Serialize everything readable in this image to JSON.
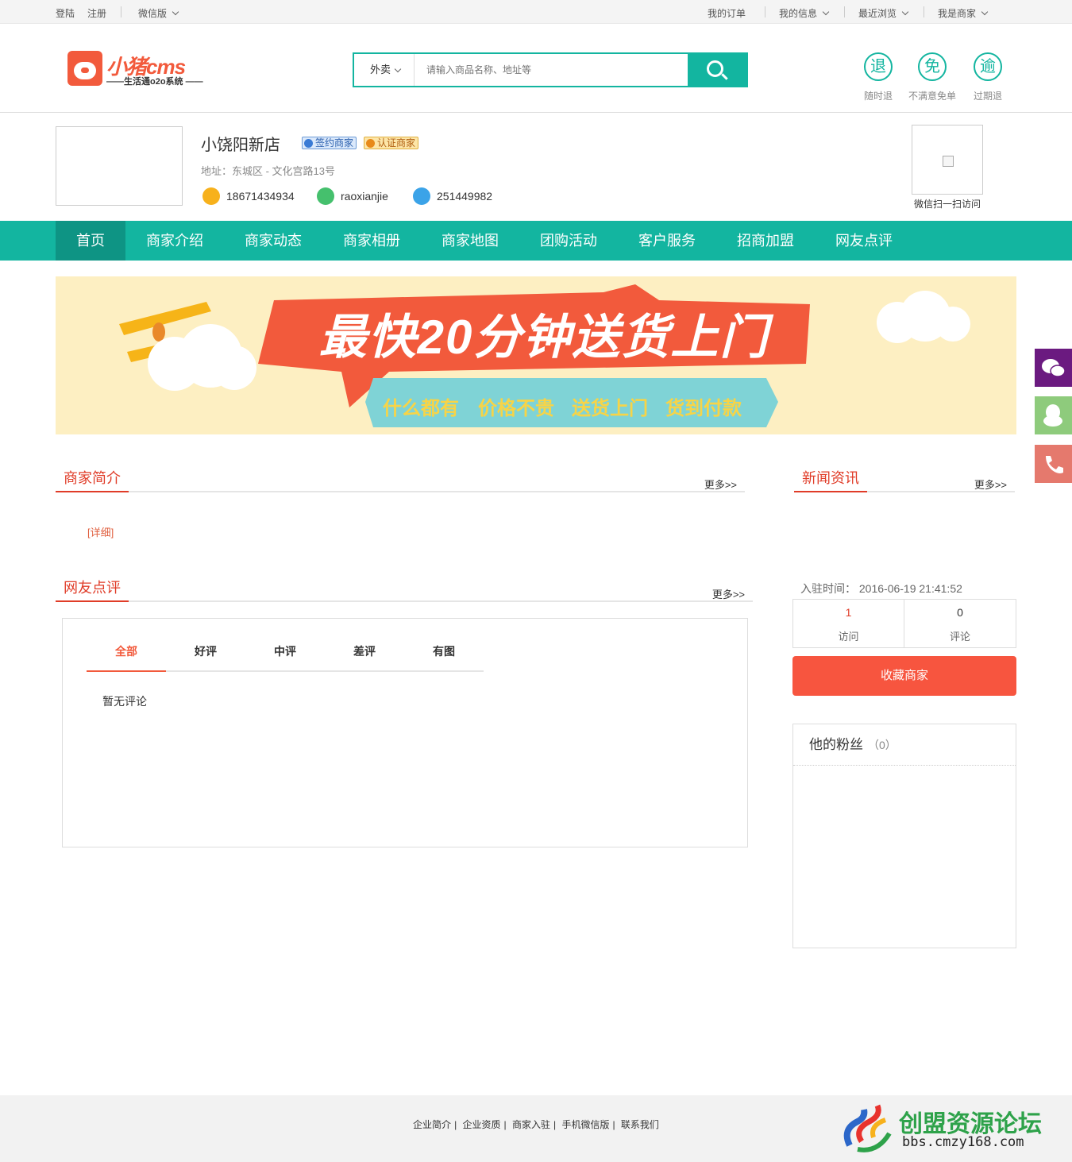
{
  "topbar": {
    "login": "登陆",
    "register": "注册",
    "wechat": "微信版",
    "my_orders": "我的订单",
    "my_info": "我的信息",
    "recent": "最近浏览",
    "merchant": "我是商家"
  },
  "header": {
    "logo_text": "小猪cms",
    "logo_sub": "——生活通o2o系统 ——",
    "search_category": "外卖",
    "search_placeholder": "请输入商品名称、地址等",
    "promises": [
      {
        "icon": "退",
        "label": "随时退"
      },
      {
        "icon": "免",
        "label": "不满意免单"
      },
      {
        "icon": "逾",
        "label": "过期退"
      }
    ]
  },
  "shop": {
    "name": "小饶阳新店",
    "badge_signed": "签约商家",
    "badge_certified": "认证商家",
    "address": "地址：东城区 - 文化宫路13号",
    "phone": "18671434934",
    "wechat": "raoxianjie",
    "qq": "251449982",
    "qr_label": "微信扫一扫访问"
  },
  "nav": [
    "首页",
    "商家介绍",
    "商家动态",
    "商家相册",
    "商家地图",
    "团购活动",
    "客户服务",
    "招商加盟",
    "网友点评"
  ],
  "banner": {
    "headline": "最快20分钟送货上门",
    "tags": [
      "什么都有",
      "价格不贵",
      "送货上门",
      "货到付款"
    ]
  },
  "intro": {
    "title": "商家简介",
    "more": "更多>>",
    "detail": "[详细]"
  },
  "news": {
    "title": "新闻资讯",
    "more": "更多>>"
  },
  "reviews": {
    "title": "网友点评",
    "more": "更多>>",
    "tabs": [
      "全部",
      "好评",
      "中评",
      "差评",
      "有图"
    ],
    "empty": "暂无评论"
  },
  "stats": {
    "join_label": "入驻时间：",
    "join_time": "2016-06-19 21:41:52",
    "visits": "1",
    "visits_label": "访问",
    "comments": "0",
    "comments_label": "评论",
    "fav_button": "收藏商家"
  },
  "fans": {
    "title": "他的粉丝",
    "count": "（0）"
  },
  "footer": {
    "links": [
      "企业简介",
      "企业资质",
      "商家入驻",
      "手机微信版",
      "联系我们"
    ]
  },
  "watermark": {
    "title": "创盟资源论坛",
    "url": "bbs.cmzy168.com"
  },
  "colors": {
    "teal": "#13b5a0",
    "teal_dark": "#0e9484",
    "red": "#e03c28",
    "orange": "#f7553f"
  }
}
